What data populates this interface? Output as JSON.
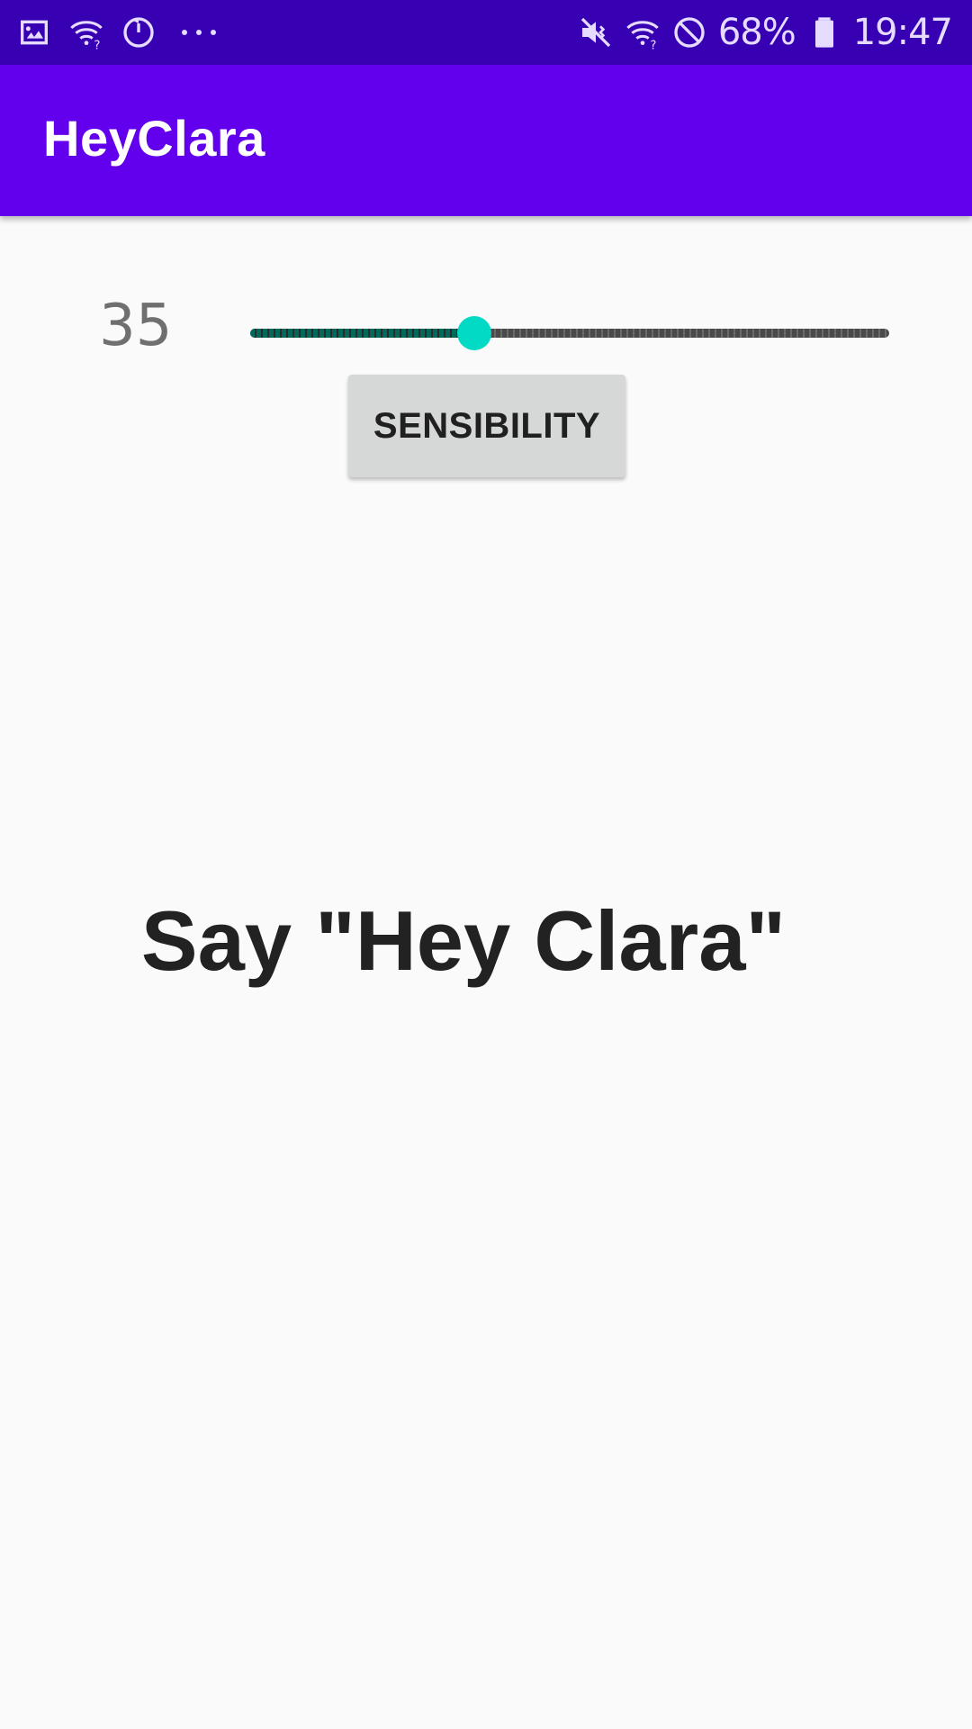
{
  "status_bar": {
    "left_icons": [
      "gallery-icon",
      "wifi-question-icon",
      "sync-icon",
      "more-dots-icon"
    ],
    "right_icons": [
      "mute-vibrate-icon",
      "wifi-icon",
      "do-not-disturb-icon",
      "battery-icon"
    ],
    "battery_percent": "68%",
    "time": "19:47"
  },
  "app_bar": {
    "title": "HeyClara",
    "color": "#6200ee",
    "status_color": "#3700b3"
  },
  "sensitivity": {
    "value_label": "35",
    "value": 35,
    "max": 100,
    "thumb_color": "#03dac5",
    "button_label": "SENSIBILITY"
  },
  "prompt": {
    "text": "Say \"Hey Clara\""
  }
}
